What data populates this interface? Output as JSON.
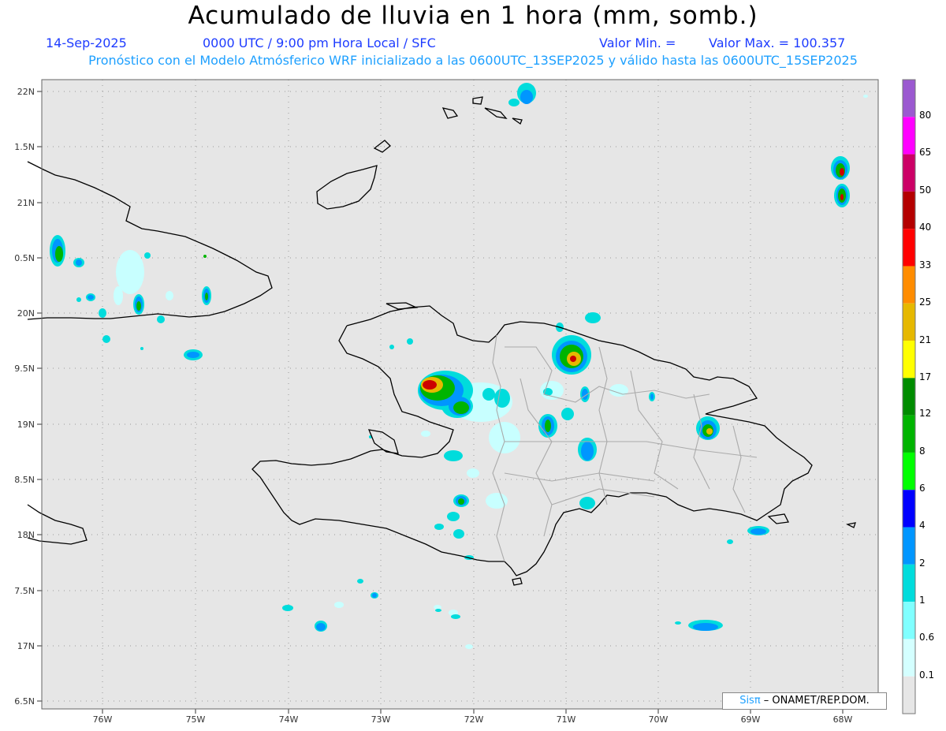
{
  "header": {
    "title": "Acumulado de lluvia en 1 hora (mm, somb.)",
    "date": "14-Sep-2025",
    "time": "0000 UTC / 9:00 pm Hora Local / SFC",
    "min_label": "Valor Min. =",
    "max_label": "Valor Max. = 100.357",
    "subtitle": "Pronóstico con el Modelo Atmósferico WRF inicializado a las 0600UTC_13SEP2025 y válido hasta las  0600UTC_15SEP2025"
  },
  "axes": {
    "lat_labels": [
      "22N",
      "1.5N",
      "21N",
      "0.5N",
      "20N",
      "9.5N",
      "19N",
      "8.5N",
      "18N",
      "7.5N",
      "17N",
      "6.5N"
    ],
    "lon_labels": [
      "76W",
      "75W",
      "74W",
      "73W",
      "72W",
      "71W",
      "70W",
      "69W",
      "68W"
    ]
  },
  "colorbar": {
    "labels": [
      "80",
      "65",
      "50",
      "40",
      "33",
      "25",
      "21",
      "17",
      "12",
      "8",
      "6",
      "4",
      "2",
      "1",
      "0.6",
      "0.1"
    ],
    "colors": [
      "#9b59d0",
      "#ff00ff",
      "#cc0066",
      "#b40000",
      "#ff0000",
      "#ff8c00",
      "#e6b800",
      "#ffff00",
      "#008c00",
      "#00b400",
      "#00ff00",
      "#0000ff",
      "#0096ff",
      "#00dcdc",
      "#80ffff",
      "#d4ffff",
      "#e6e6e6"
    ]
  },
  "credit": {
    "brand": "Sisπ",
    "text": " – ONAMET/REP.DOM."
  }
}
